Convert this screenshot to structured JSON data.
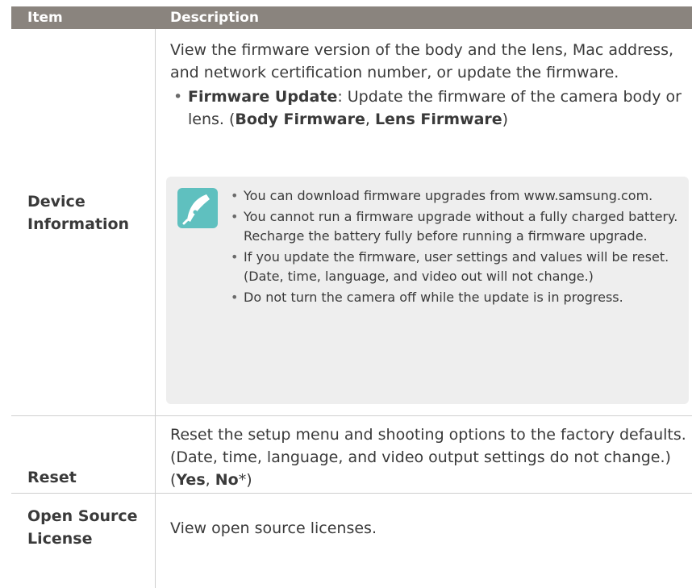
{
  "header": {
    "item": "Item",
    "description": "Description"
  },
  "rows": [
    {
      "item": "Device Information",
      "description": "View the firmware version of the body and the lens, Mac address, and network certification number, or update the firmware.",
      "bullet": {
        "bold": "Firmware Update",
        "text": ": Update the firmware of the camera body or lens. (",
        "opt1": "Body Firmware",
        "sep": ", ",
        "opt2": "Lens Firmware",
        "close": ")"
      },
      "note_icon": "pen-nib-icon",
      "notes": [
        "You can download firmware upgrades from www.samsung.com.",
        "You cannot run a firmware upgrade without a fully charged battery. Recharge the battery fully before running a firmware upgrade.",
        "If you update the firmware, user settings and values will be reset. (Date, time, language, and video out will not change.)",
        "Do not turn the camera off while the update is in progress."
      ]
    },
    {
      "item": "Reset",
      "description": "Reset the setup menu and shooting options to the factory defaults. (Date, time, language, and video output settings do not change.) (",
      "opt1": "Yes",
      "sep": ", ",
      "opt2": "No",
      "tail": "*)"
    },
    {
      "item": "Open Source License",
      "description": "View open source licenses."
    }
  ],
  "colors": {
    "header_bg": "#8a847e",
    "note_bg": "#eeeeee",
    "icon_bg": "#5fc0bf"
  }
}
